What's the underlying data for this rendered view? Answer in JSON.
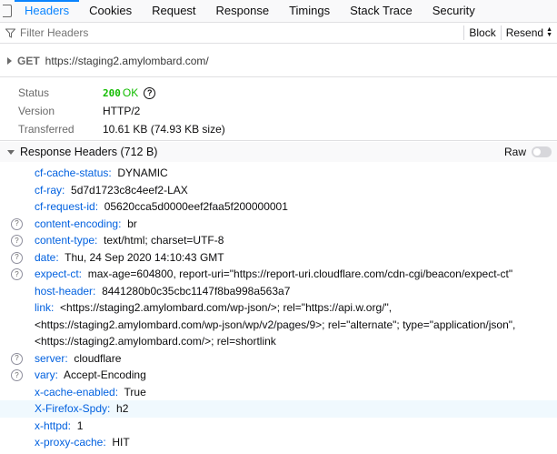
{
  "tabs": [
    {
      "label": "Headers",
      "active": true
    },
    {
      "label": "Cookies",
      "active": false
    },
    {
      "label": "Request",
      "active": false
    },
    {
      "label": "Response",
      "active": false
    },
    {
      "label": "Timings",
      "active": false
    },
    {
      "label": "Stack Trace",
      "active": false
    },
    {
      "label": "Security",
      "active": false
    }
  ],
  "filter": {
    "placeholder": "Filter Headers",
    "icon": "filter-icon"
  },
  "actions": {
    "block_label": "Block",
    "resend_label": "Resend"
  },
  "request": {
    "method": "GET",
    "url": "https://staging2.amylombard.com/"
  },
  "summary": {
    "status_label": "Status",
    "status_code": "200",
    "status_text": "OK",
    "version_label": "Version",
    "version_value": "HTTP/2",
    "transferred_label": "Transferred",
    "transferred_value": "10.61 KB (74.93 KB size)"
  },
  "response_headers": {
    "title": "Response Headers (712 B)",
    "raw_label": "Raw",
    "raw_enabled": false,
    "items": [
      {
        "name": "cf-cache-status:",
        "value": "DYNAMIC",
        "help": false
      },
      {
        "name": "cf-ray:",
        "value": "5d7d1723c8c4eef2-LAX",
        "help": false
      },
      {
        "name": "cf-request-id:",
        "value": "05620cca5d0000eef2faa5f200000001",
        "help": false
      },
      {
        "name": "content-encoding:",
        "value": "br",
        "help": true
      },
      {
        "name": "content-type:",
        "value": "text/html; charset=UTF-8",
        "help": true
      },
      {
        "name": "date:",
        "value": "Thu, 24 Sep 2020 14:10:43 GMT",
        "help": true
      },
      {
        "name": "expect-ct:",
        "value": "max-age=604800, report-uri=\"https://report-uri.cloudflare.com/cdn-cgi/beacon/expect-ct\"",
        "help": true
      },
      {
        "name": "host-header:",
        "value": "8441280b0c35cbc1147f8ba998a563a7",
        "help": false
      },
      {
        "name": "link:",
        "value": "<https://staging2.amylombard.com/wp-json/>; rel=\"https://api.w.org/\", <https://staging2.amylombard.com/wp-json/wp/v2/pages/9>; rel=\"alternate\"; type=\"application/json\", <https://staging2.amylombard.com/>; rel=shortlink",
        "help": false
      },
      {
        "name": "server:",
        "value": "cloudflare",
        "help": true
      },
      {
        "name": "vary:",
        "value": "Accept-Encoding",
        "help": true
      },
      {
        "name": "x-cache-enabled:",
        "value": "True",
        "help": false
      },
      {
        "name": "X-Firefox-Spdy:",
        "value": "h2",
        "help": false,
        "highlight": true
      },
      {
        "name": "x-httpd:",
        "value": "1",
        "help": false
      },
      {
        "name": "x-proxy-cache:",
        "value": "HIT",
        "help": false
      }
    ]
  }
}
